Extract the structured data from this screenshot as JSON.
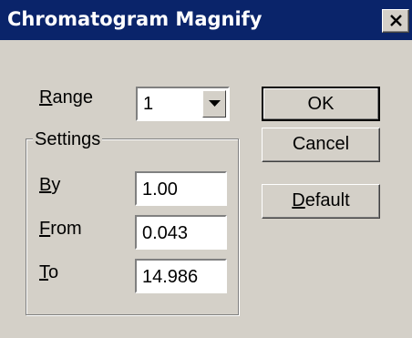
{
  "window": {
    "title": "Chromatogram Magnify"
  },
  "range": {
    "label_first": "R",
    "label_rest": "ange",
    "value": "1"
  },
  "settings": {
    "title": "Settings",
    "by": {
      "label_first": "B",
      "label_rest": "y",
      "value": "1.00"
    },
    "from": {
      "label_first": "F",
      "label_rest": "rom",
      "value": "0.043"
    },
    "to": {
      "label_first": "T",
      "label_rest": "o",
      "value": "14.986"
    }
  },
  "buttons": {
    "ok": "OK",
    "cancel": "Cancel",
    "default_first": "D",
    "default_rest": "efault"
  }
}
